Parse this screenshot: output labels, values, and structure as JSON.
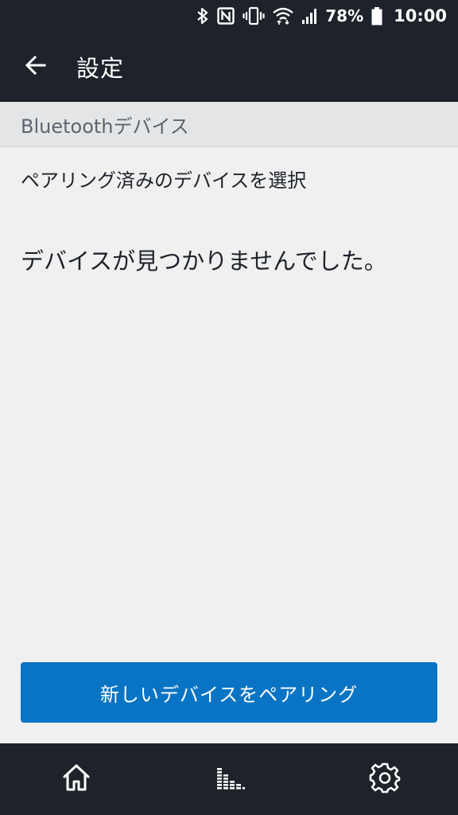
{
  "status_bar": {
    "battery_percent": "78%",
    "time": "10:00",
    "icons": [
      "bluetooth-icon",
      "nfc-icon",
      "vibrate-icon",
      "wifi-icon",
      "signal-icon",
      "battery-icon"
    ]
  },
  "app_bar": {
    "title": "設定",
    "back_icon": "arrow-left-icon"
  },
  "section": {
    "header": "Bluetoothデバイス",
    "subtitle": "ペアリング済みのデバイスを選択",
    "empty_message": "デバイスが見つかりませんでした。"
  },
  "actions": {
    "pair_button_label": "新しいデバイスをペアリング"
  },
  "bottom_nav": {
    "items": [
      "home-icon",
      "equalizer-icon",
      "gear-icon"
    ]
  },
  "colors": {
    "bar_background": "#1e232b",
    "content_background": "#f0f0f0",
    "section_header_background": "#e4e5e6",
    "primary_button": "#0a74c4"
  }
}
